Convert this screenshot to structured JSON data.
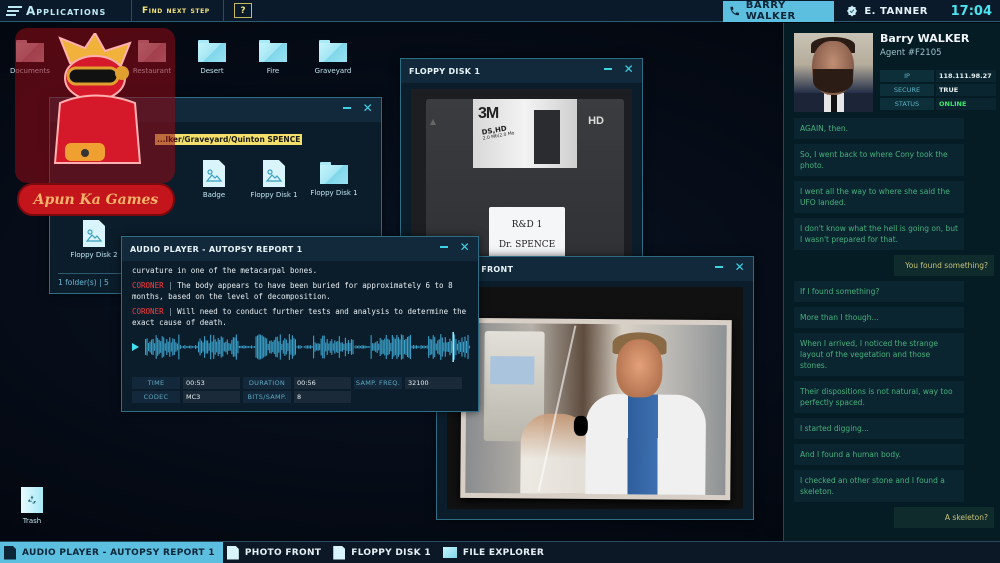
{
  "topbar": {
    "apps_label": "Applications",
    "find_step_label": "Find next step",
    "help_label": "?",
    "contact_label": "BARRY WALKER",
    "user_label": "E. TANNER",
    "clock": "17:04"
  },
  "desktop": {
    "icons": [
      {
        "label": "Documents",
        "type": "folder"
      },
      {
        "label": "Restaurant",
        "type": "folder"
      },
      {
        "label": "Desert",
        "type": "folder"
      },
      {
        "label": "Fire",
        "type": "folder"
      },
      {
        "label": "Graveyard",
        "type": "folder"
      }
    ],
    "trash_label": "Trash"
  },
  "file_explorer": {
    "title": "FILE EXPLORER",
    "path": "...lker/Graveyard/Quinton SPENCE",
    "items": [
      {
        "label": "Badge",
        "type": "image"
      },
      {
        "label": "Floppy Disk 1",
        "type": "image"
      },
      {
        "label": "Floppy Disk 1",
        "type": "folder"
      },
      {
        "label": "Floppy Disk 2",
        "type": "image"
      }
    ],
    "footer": "1 folder(s)  |  5"
  },
  "floppy_window": {
    "title": "FLOPPY DISK 1",
    "disk_brand": "3M",
    "disk_type": "DS,HD",
    "disk_capacity": "2.0 Mb/2.0 Mo",
    "hd_mark": "HD",
    "label_line1": "R&D 1",
    "label_line2": "Dr. SPENCE"
  },
  "photo_window": {
    "title": "PHOTO FRONT"
  },
  "audio_player": {
    "title": "AUDIO PLAYER - AUTOPSY REPORT 1",
    "transcript": [
      {
        "speaker": "",
        "text": "curvature in one of the metacarpal bones."
      },
      {
        "speaker": "CORONER",
        "text": "The body appears to have been buried for approximately 6 to 8 months, based on the level of decomposition."
      },
      {
        "speaker": "CORONER",
        "text": "Will need to conduct further tests and analysis to determine the exact cause of death."
      }
    ],
    "progress": 0.946,
    "meta": {
      "time_label": "TIME",
      "time": "00:53",
      "duration_label": "DURATION",
      "duration": "00:56",
      "freq_label": "SAMP. FREQ.",
      "freq": "32100",
      "codec_label": "CODEC",
      "codec": "MC3",
      "bits_label": "BITS/SAMP.",
      "bits": "8"
    }
  },
  "contact_panel": {
    "name": "Barry WALKER",
    "agent_id": "Agent #F2105",
    "ip_label": "IP",
    "ip": "118.111.98.27",
    "secure_label": "SECURE",
    "secure": "TRUE",
    "status_label": "STATUS",
    "status": "ONLINE",
    "status_color": "#3ee86a",
    "messages": [
      {
        "from": "them",
        "text": "AGAIN, then."
      },
      {
        "from": "them",
        "text": "So, I went back to where Cony took the photo."
      },
      {
        "from": "them",
        "text": "I went all the way to where she said the UFO landed."
      },
      {
        "from": "them",
        "text": "I don't know what the hell is going on, but I wasn't prepared for that."
      },
      {
        "from": "me",
        "text": "You found something?"
      },
      {
        "from": "them",
        "text": "If I found something?"
      },
      {
        "from": "them",
        "text": "More than I though..."
      },
      {
        "from": "them",
        "text": "When I arrived, I noticed the strange layout of the vegetation and those stones."
      },
      {
        "from": "them",
        "text": "Their dispositions is not natural, way too perfectly spaced."
      },
      {
        "from": "them",
        "text": "I started digging..."
      },
      {
        "from": "them",
        "text": "And I found a human body."
      },
      {
        "from": "them",
        "text": "I checked an other stone and I found a skeleton."
      },
      {
        "from": "me",
        "text": "A skeleton?"
      }
    ]
  },
  "taskbar": {
    "items": [
      {
        "label": "AUDIO PLAYER - AUTOPSY REPORT 1",
        "active": true
      },
      {
        "label": "PHOTO FRONT",
        "active": false
      },
      {
        "label": "FLOPPY DISK 1",
        "active": false
      },
      {
        "label": "FILE EXPLORER",
        "active": false
      }
    ]
  },
  "watermark": {
    "text": "Apun Ka Games"
  },
  "colors": {
    "accent": "#5cbfe0",
    "title_yellow": "#f2e27a",
    "coroner_red": "#ff3b3b",
    "clock_cyan": "#4ce3ef"
  }
}
